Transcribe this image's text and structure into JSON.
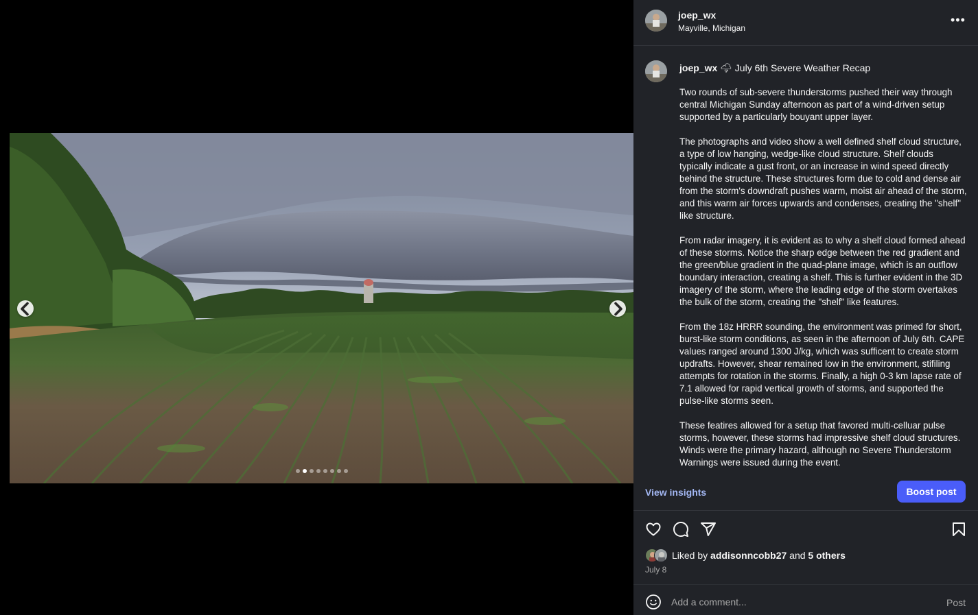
{
  "header": {
    "username": "joep_wx",
    "location": "Mayville, Michigan",
    "more_label": "•••"
  },
  "carousel": {
    "slide_count": 8,
    "active_index": 1,
    "prev_icon": "chevron-left-icon",
    "next_icon": "chevron-right-icon"
  },
  "caption": {
    "username": "joep_wx",
    "title": " 🌩 July 6th Severe Weather Recap",
    "paragraphs": [
      "Two rounds of sub-severe thunderstorms pushed their way through central Michigan Sunday afternoon as part of a wind-driven setup supported by a particularly bouyant upper layer.",
      "The photographs and video show a well defined shelf cloud structure, a type of low hanging, wedge-like cloud structure. Shelf clouds typically indicate a gust front, or an increase in wind speed directly behind the structure. These structures form due to cold and dense air from the storm's downdraft pushes warm, moist air ahead of the storm, and this warm air forces upwards and condenses, creating the \"shelf\" like structure.",
      "From radar imagery, it is evident as to why a shelf cloud formed ahead of these storms. Notice the sharp edge between the red gradient and the green/blue gradient in the quad-plane image, which is an outflow boundary interaction, creating a shelf. This is further evident in the 3D imagery of the storm, where the leading edge of the storm overtakes the bulk of the storm, creating the \"shelf\" like features.",
      "From the 18z HRRR sounding, the environment was primed for short, burst-like storm conditions, as seen in the afternoon of July 6th. CAPE values ranged around 1300 J/kg, which was sufficent to create storm updrafts. However, shear remained low in the environment, stifiling attempts for rotation in the storms. Finally, a high 0-3 km lapse rate of 7.1 allowed for rapid vertical growth of storms, and supported the pulse-like storms seen.",
      "These featires allowed for a setup that favored multi-celluar pulse storms, however, these storms had impressive shelf cloud structures. Winds were the primary hazard, although no Severe Thunderstorm Warnings were issued during the event."
    ]
  },
  "insights": {
    "view_label": "View insights",
    "boost_label": "Boost post"
  },
  "actions": {
    "like_icon": "heart-icon",
    "comment_icon": "comment-icon",
    "share_icon": "share-icon",
    "save_icon": "bookmark-icon"
  },
  "likes": {
    "prefix": "Liked by ",
    "user": "addisonncobb27",
    "middle": " and ",
    "others": "5 others"
  },
  "date": "July 8",
  "comment": {
    "placeholder": "Add a comment...",
    "post_label": "Post",
    "emoji_icon": "smiley-icon"
  },
  "colors": {
    "panel_bg": "#212328",
    "accent_blue": "#4a5df9",
    "insights_link": "#a3b7f3"
  }
}
